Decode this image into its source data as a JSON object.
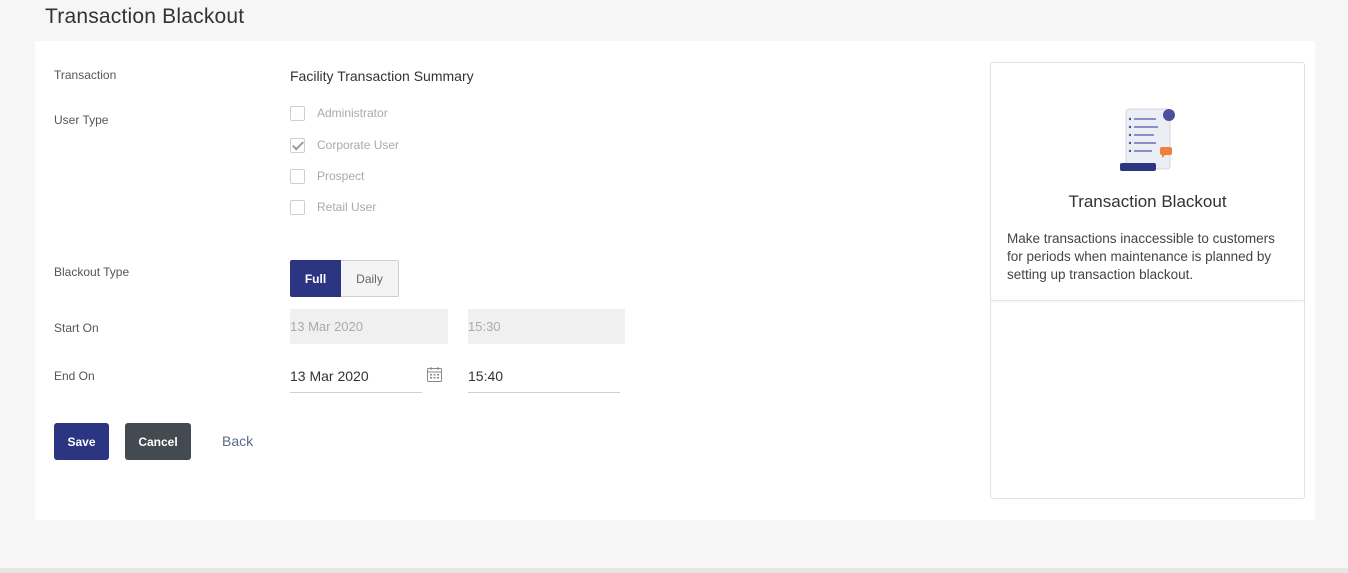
{
  "page": {
    "title": "Transaction Blackout"
  },
  "form": {
    "transaction": {
      "label": "Transaction",
      "value": "Facility Transaction Summary"
    },
    "user_type": {
      "label": "User Type",
      "options": [
        {
          "label": "Administrator",
          "checked": false
        },
        {
          "label": "Corporate User",
          "checked": true
        },
        {
          "label": "Prospect",
          "checked": false
        },
        {
          "label": "Retail User",
          "checked": false
        }
      ]
    },
    "blackout_type": {
      "label": "Blackout Type",
      "options": [
        "Full",
        "Daily"
      ],
      "selected": "Full"
    },
    "start_on": {
      "label": "Start On",
      "date": "13 Mar 2020",
      "time": "15:30"
    },
    "end_on": {
      "label": "End On",
      "date": "13 Mar 2020",
      "time": "15:40"
    }
  },
  "actions": {
    "save": "Save",
    "cancel": "Cancel",
    "back": "Back"
  },
  "info_panel": {
    "title": "Transaction Blackout",
    "description": "Make transactions inaccessible to customers for periods when maintenance is planned by setting up transaction blackout."
  },
  "colors": {
    "primary": "#2b3581",
    "cancel": "#444a52",
    "link": "#5a6a8a"
  }
}
